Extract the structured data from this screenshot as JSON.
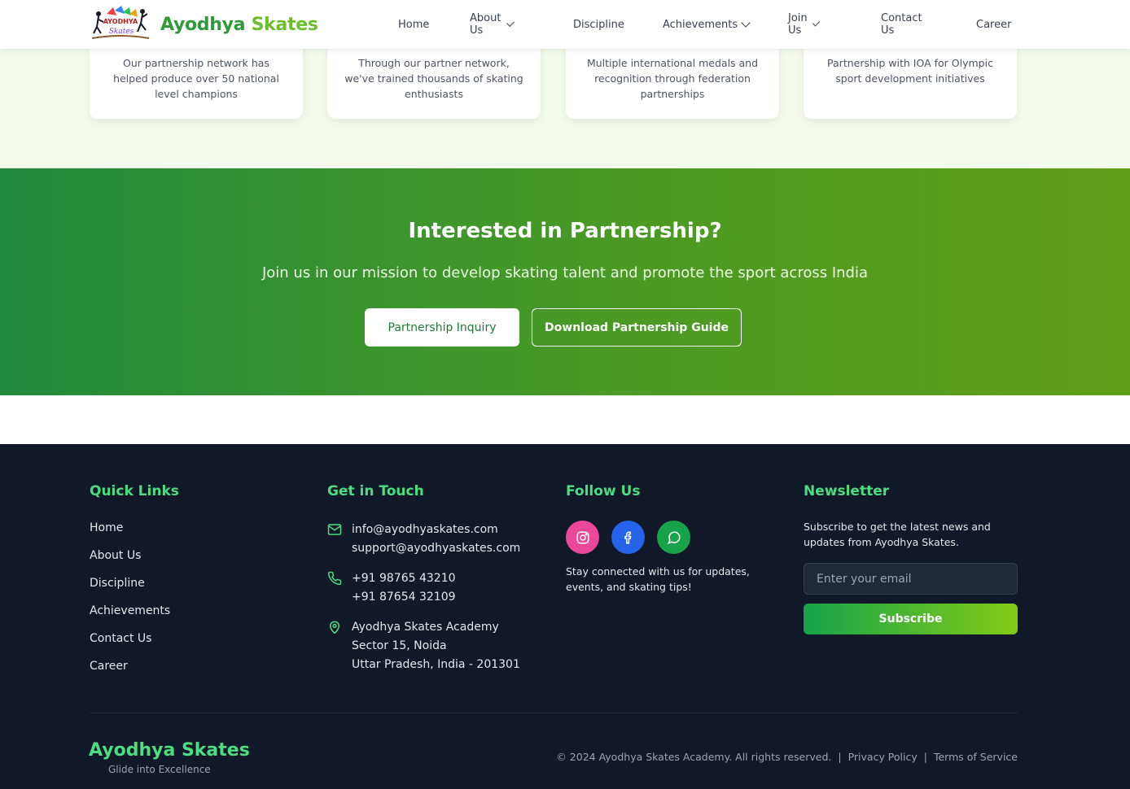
{
  "header": {
    "brand_part1": "Ayodhya",
    "brand_part2": "Skates",
    "logo_text": "AYODHYA",
    "logo_script": "Skates",
    "nav": [
      {
        "label": "Home",
        "dropdown": false
      },
      {
        "label": "About Us",
        "dropdown": true
      },
      {
        "label": "Discipline",
        "dropdown": false
      },
      {
        "label": "Achievements",
        "dropdown": true
      },
      {
        "label": "Join Us",
        "dropdown": true
      },
      {
        "label": "Contact Us",
        "dropdown": false
      },
      {
        "label": "Career",
        "dropdown": false
      }
    ]
  },
  "stats": {
    "cards": [
      {
        "text": "Our partnership network has helped produce over 50 national level champions"
      },
      {
        "text": "Through our partner network, we've trained thousands of skating enthusiasts"
      },
      {
        "text": "Multiple international medals and recognition through federation partnerships"
      },
      {
        "text": "Partnership with IOA for Olympic sport development initiatives"
      }
    ]
  },
  "cta": {
    "title": "Interested in Partnership?",
    "subtitle": "Join us in our mission to develop skating talent and promote the sport across India",
    "primary_label": "Partnership Inquiry",
    "secondary_label": "Download Partnership Guide"
  },
  "footer": {
    "quick_links": {
      "title": "Quick Links",
      "items": [
        "Home",
        "About Us",
        "Discipline",
        "Achievements",
        "Contact Us",
        "Career"
      ]
    },
    "contact": {
      "title": "Get in Touch",
      "email_lines": [
        "info@ayodhyaskates.com",
        "support@ayodhyaskates.com"
      ],
      "phone_lines": [
        "+91 98765 43210",
        "+91 87654 32109"
      ],
      "address_lines": [
        "Ayodhya Skates Academy",
        "Sector 15, Noida",
        "Uttar Pradesh, India - 201301"
      ]
    },
    "follow": {
      "title": "Follow Us",
      "socials": [
        {
          "icon": "instagram-icon",
          "color": "#ec4899"
        },
        {
          "icon": "facebook-icon",
          "color": "#2563eb"
        },
        {
          "icon": "whatsapp-icon",
          "color": "#16a34a"
        }
      ],
      "text": "Stay connected with us for updates, events, and skating tips!"
    },
    "newsletter": {
      "title": "Newsletter",
      "text": "Subscribe to get the latest news and updates from Ayodhya Skates.",
      "placeholder": "Enter your email",
      "button": "Subscribe"
    },
    "brand": "Ayodhya Skates",
    "tagline": "Glide into Excellence",
    "copyright": "© 2024 Ayodhya Skates Academy. All rights reserved.",
    "separator": "|",
    "privacy": "Privacy Policy",
    "terms": "Terms of Service"
  },
  "colors": {
    "accent_green": "#4ade80",
    "brand_green": "#2e9a3a",
    "footer_bg": "#111827",
    "cta_gradient_start": "#218a3b",
    "cta_gradient_end": "#5f9f18"
  }
}
